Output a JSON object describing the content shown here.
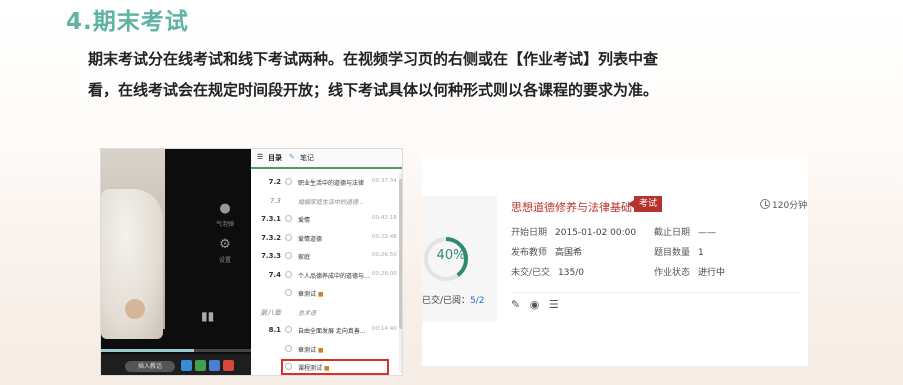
{
  "section": {
    "title": "4.期末考试",
    "intro_line1": "期末考试分在线考试和线下考试两种。在视频学习页的右侧或在【作业考试】列表中查",
    "intro_line2": "看，在线考试会在规定时间段开放；线下考试具体以何种形式则以各课程的要求为准。"
  },
  "player": {
    "side_buttons": [
      {
        "icon": "comment-icon",
        "label": "气泡弹"
      },
      {
        "icon": "settings-icon",
        "label": "设置"
      }
    ],
    "bottom_pill": "插入教话",
    "progress": 0.62
  },
  "catalog": {
    "tabs": [
      "目录",
      "笔记"
    ],
    "rows": [
      {
        "num": "7.2",
        "title": "职业生活中的道德与法律",
        "dur": "00:37:34"
      },
      {
        "num": "7.3",
        "title": "婚姻家庭生活中的道德...",
        "dur": "",
        "italic": true
      },
      {
        "num": "7.3.1",
        "title": "爱情",
        "dur": "00:42:18"
      },
      {
        "num": "7.3.2",
        "title": "爱情道德",
        "dur": "00:22:48"
      },
      {
        "num": "7.3.3",
        "title": "家庭",
        "dur": "00:26:50"
      },
      {
        "num": "7.4",
        "title": "个人品德养成中的道德与...",
        "dur": "00:28:00"
      },
      {
        "num": "",
        "title": "章测试",
        "dur": "",
        "exam": true
      },
      {
        "num": "第八章",
        "title": "总术语",
        "dur": "",
        "italic": true
      },
      {
        "num": "8.1",
        "title": "自由全面发展 走向真善...",
        "dur": "00:14:40"
      },
      {
        "num": "",
        "title": "章测试",
        "dur": "",
        "exam": true
      },
      {
        "num": "",
        "title": "课程测试",
        "dur": "",
        "exam": true,
        "highlight": true
      }
    ]
  },
  "exam_card": {
    "progress_label": "40%",
    "progress_value": 0.4,
    "submitted_label": "已交/已阅：",
    "submitted_value": "5/2",
    "name": "思想道德修养与法律基础",
    "tag": "考试",
    "duration": "120分钟",
    "start_label": "开始日期",
    "start_value": "2015-01-02 00:00",
    "end_label": "截止日期",
    "end_value": "——",
    "teacher_label": "发布教师",
    "teacher_value": "高国希",
    "count_label": "题目数量",
    "count_value": "1",
    "submit_label": "未交/已交",
    "submit_value": "135/0",
    "status_label": "作业状态",
    "status_value": "进行中"
  },
  "colors": {
    "title": "#5eb3a3",
    "accent_red": "#b5322d",
    "ring": "#2f8a74",
    "highlight_box": "#d9302b"
  }
}
